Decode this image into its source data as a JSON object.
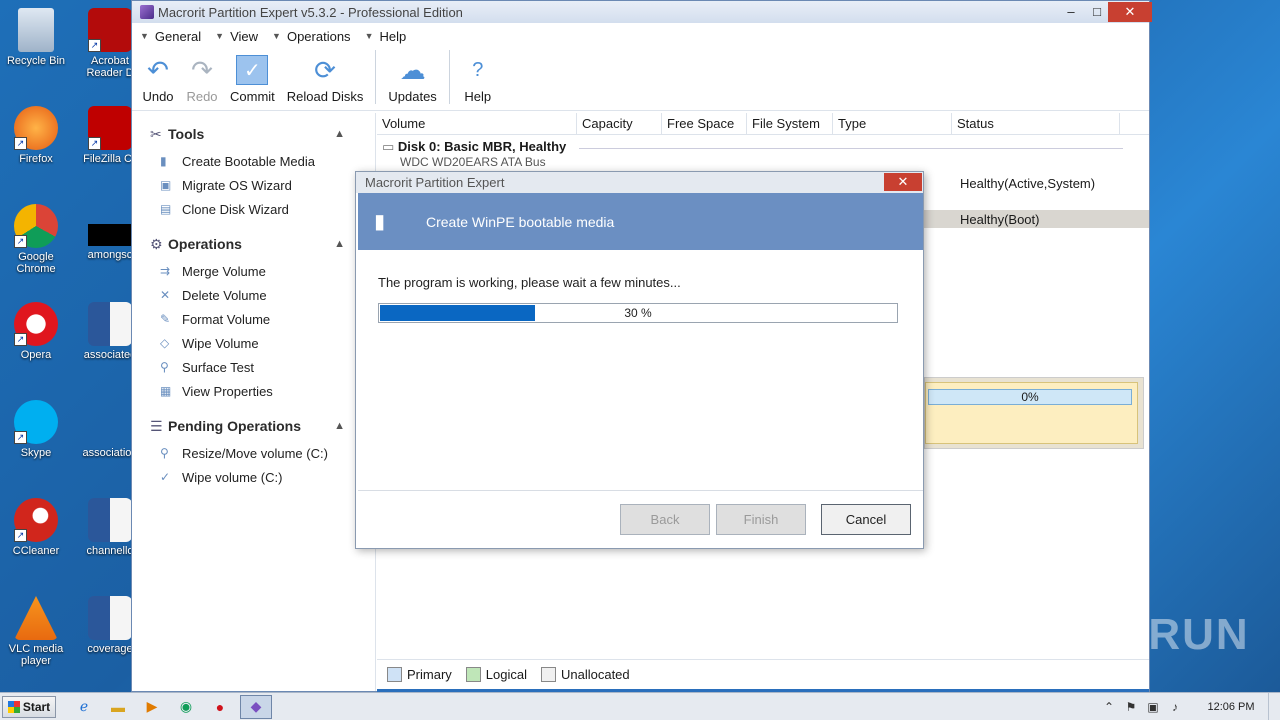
{
  "desktop": {
    "icons": [
      {
        "label": "Recycle Bin"
      },
      {
        "label": "Acrobat Reader D"
      },
      {
        "label": "Firefox"
      },
      {
        "label": "FileZilla Cli"
      },
      {
        "label": "Google Chrome"
      },
      {
        "label": "amongsc"
      },
      {
        "label": "Opera"
      },
      {
        "label": "associated"
      },
      {
        "label": "Skype"
      },
      {
        "label": "association"
      },
      {
        "label": "CCleaner"
      },
      {
        "label": "channello"
      },
      {
        "label": "VLC media player"
      },
      {
        "label": "coverage"
      }
    ]
  },
  "window": {
    "title": "Macrorit Partition Expert v5.3.2 - Professional Edition",
    "menu": [
      "General",
      "View",
      "Operations",
      "Help"
    ],
    "toolbar": {
      "undo": "Undo",
      "redo": "Redo",
      "commit": "Commit",
      "reload": "Reload Disks",
      "updates": "Updates",
      "help": "Help"
    },
    "sidebar": {
      "tools_title": "Tools",
      "tools": [
        "Create Bootable Media",
        "Migrate OS Wizard",
        "Clone Disk Wizard"
      ],
      "operations_title": "Operations",
      "operations": [
        "Merge Volume",
        "Delete Volume",
        "Format Volume",
        "Wipe Volume",
        "Surface Test",
        "View Properties"
      ],
      "pending_title": "Pending Operations",
      "pending": [
        "Resize/Move volume (C:)",
        "Wipe volume (C:)"
      ]
    },
    "columns": [
      "Volume",
      "Capacity",
      "Free Space",
      "File System",
      "Type",
      "Status"
    ],
    "disk": {
      "title": "Disk 0: Basic MBR, Healthy",
      "subtitle": "WDC WD20EARS ATA Bus",
      "status1": "Healthy(Active,System)",
      "status2": "Healthy(Boot)",
      "map_percent": "0%"
    },
    "legend": [
      "Primary",
      "Logical",
      "Unallocated"
    ],
    "legend_colors": {
      "primary": "#cfe2f6",
      "logical": "#bfe6b8",
      "unallocated": "#f0f0f0"
    }
  },
  "dialog": {
    "title": "Macrorit Partition Expert",
    "banner": "Create WinPE bootable media",
    "message": "The program is working, please wait a few minutes...",
    "progress_value": 0.3,
    "progress_text": "30 %",
    "back": "Back",
    "finish": "Finish",
    "cancel": "Cancel"
  },
  "taskbar": {
    "start": "Start",
    "clock": "12:06 PM"
  },
  "watermark": "ANY RUN"
}
